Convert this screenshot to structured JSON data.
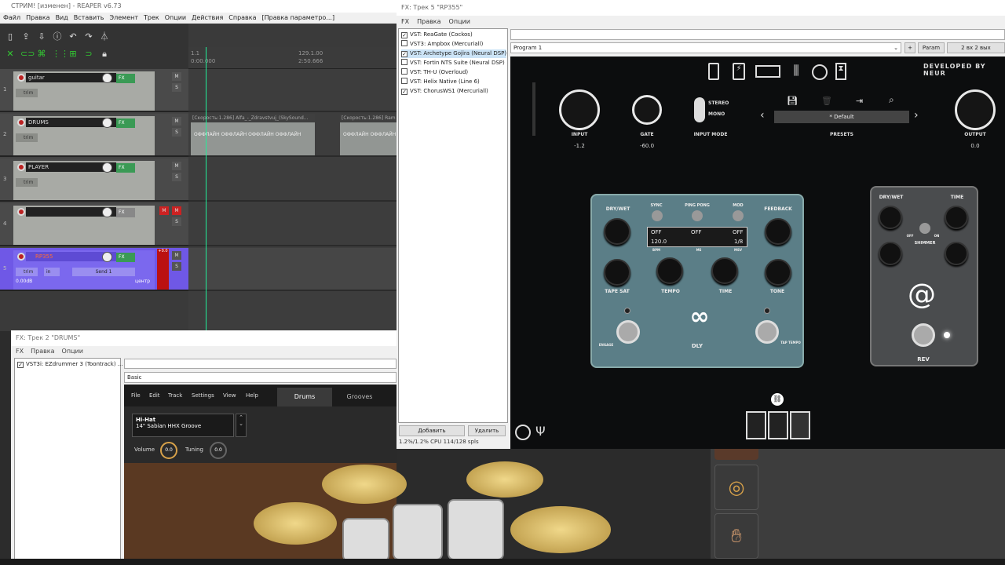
{
  "reaper": {
    "title": "СТРИМ! [изменен] - REAPER v6.73",
    "menu": [
      "Файл",
      "Правка",
      "Вид",
      "Вставить",
      "Элемент",
      "Трек",
      "Опции",
      "Действия",
      "Справка",
      "[Правка параметро...]"
    ],
    "ruler": {
      "mark1": "1.1",
      "time1": "0:00.000",
      "mark2": "129.1.00",
      "time2": "2:50.666"
    },
    "tracks": [
      {
        "num": "1",
        "name": "guitar",
        "fx": "FX",
        "trim": "trim"
      },
      {
        "num": "2",
        "name": "DRUMS",
        "fx": "FX",
        "trim": "trim"
      },
      {
        "num": "3",
        "name": "PLAYER",
        "fx": "FX",
        "trim": "trim"
      },
      {
        "num": "4",
        "name": "",
        "fx": "FX",
        "trim": ""
      },
      {
        "num": "5",
        "name": "RP355",
        "fx": "FX",
        "trim": "trim",
        "in": "in",
        "send": "Send 1",
        "vol": "0.00dB",
        "pan": "центр",
        "meter": "+0.0"
      }
    ],
    "items": [
      {
        "label": "[Скорость:1.286] Alfa_-_Zdravstvuj_(SkySound...",
        "sub": "ОФФЛАЙН   ОФФЛАЙН   ОФФЛАЙН   ОФФЛАЙН"
      },
      {
        "label": "[Скорость:1.286] Ram",
        "sub": "ОФФЛАЙН   ОФФЛАЙН"
      }
    ],
    "mute_label": "M",
    "solo_label": "S"
  },
  "fx_rp355": {
    "title": "FX: Трек 5 \"RP355\"",
    "menu": [
      "FX",
      "Правка",
      "Опции"
    ],
    "chain": [
      {
        "label": "VST: ReaGate (Cockos)",
        "checked": true
      },
      {
        "label": "VST3: Ampbox (Mercuriall)",
        "checked": false
      },
      {
        "label": "VST: Archetype Gojira (Neural DSP)",
        "checked": true
      },
      {
        "label": "VST: Fortin NTS Suite (Neural DSP)",
        "checked": false
      },
      {
        "label": "VST: TH-U (Overloud)",
        "checked": false
      },
      {
        "label": "VST: Helix Native (Line 6)",
        "checked": false
      },
      {
        "label": "VST: ChorusWS1 (Mercuriall)",
        "checked": true
      }
    ],
    "add_button": "Добавить",
    "remove_button": "Удалить",
    "cpu": "1.2%/1.2% CPU 114/128 spls",
    "program": "Program 1",
    "plus": "+",
    "param": "Param",
    "io": "2 вх 2 вых",
    "plugin": {
      "developed": "DEVELOPED BY NEUR",
      "input_label": "INPUT",
      "input_value": "-1.2",
      "gate_label": "GATE",
      "gate_value": "-60.0",
      "input_mode_label": "INPUT MODE",
      "stereo": "STEREO",
      "mono": "MONO",
      "preset": "* Default",
      "presets_label": "PRESETS",
      "output_label": "OUTPUT",
      "output_value": "0.0",
      "dly": {
        "dry_wet": "DRY/WET",
        "feedback": "FEEDBACK",
        "tape_sat": "TAPE SAT",
        "tempo": "TEMPO",
        "time": "TIME",
        "tone": "TONE",
        "sync": "SYNC",
        "ping_pong": "PING PONG",
        "mod": "MOD",
        "disp_off1": "OFF",
        "disp_off2": "OFF",
        "disp_off3": "OFF",
        "disp_bpm": "120.0",
        "disp_div": "1/8",
        "bpm": "BPM",
        "ms": "MS",
        "msv": "MSV",
        "engage": "ENGAGE",
        "tap_tempo": "TAP TEMPO",
        "name": "DLY"
      },
      "rev": {
        "dry_wet": "DRY/WET",
        "time": "TIME",
        "shimmer": "SHIMMER",
        "off": "OFF",
        "on": "ON",
        "name": "REV"
      }
    }
  },
  "fx_drums": {
    "title": "FX: Трек 2 \"DRUMS\"",
    "menu": [
      "FX",
      "Правка",
      "Опции"
    ],
    "chain": [
      {
        "label": "VST3i: EZdrummer 3 (Toontrack) ...",
        "checked": true
      }
    ],
    "preset": "Basic",
    "ez": {
      "menu": [
        "File",
        "Edit",
        "Track",
        "Settings",
        "View",
        "Help"
      ],
      "tabs": [
        "Drums",
        "Grooves"
      ],
      "instrument": "Hi-Hat",
      "instrument_sub": "14\" Sabian HHX Groove",
      "volume_label": "Volume",
      "volume_value": "0.0",
      "tuning_label": "Tuning",
      "tuning_value": "0.0"
    }
  }
}
